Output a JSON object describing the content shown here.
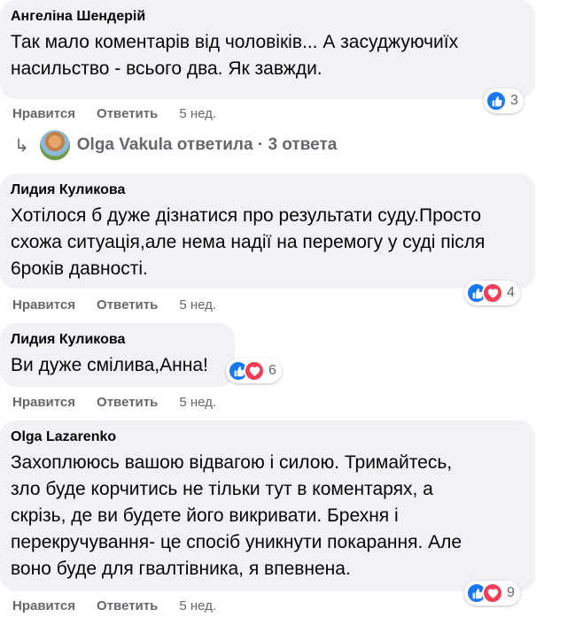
{
  "comments": [
    {
      "author": "Ангеліна Шендерій",
      "lines": [
        "Так мало коментарів від чоловіків... А засуджуючиїх",
        "насильство - всього два. Як завжди."
      ],
      "reactions": {
        "count": "3",
        "types": [
          "like"
        ]
      },
      "actions": {
        "like": "Нравится",
        "reply": "Ответить",
        "time": "5 нед."
      }
    },
    {
      "author": "Лидия Куликова",
      "lines": [
        "Хотілося б дуже дізнатися про результати суду.Просто",
        "схожа ситуація,але нема надії на перемогу у суді після",
        "6років давності."
      ],
      "reactions": {
        "count": "4",
        "types": [
          "like",
          "love"
        ]
      },
      "actions": {
        "like": "Нравится",
        "reply": "Ответить",
        "time": "5 нед."
      }
    },
    {
      "author": "Лидия Куликова",
      "lines": [
        "Ви дуже смілива,Анна!"
      ],
      "reactions": {
        "count": "6",
        "types": [
          "like",
          "love"
        ]
      },
      "actions": {
        "like": "Нравится",
        "reply": "Ответить",
        "time": "5 нед."
      }
    },
    {
      "author": "Olga Lazarenko",
      "lines": [
        "Захоплююсь вашою відвагою і силою. Тримайтесь,",
        "зло буде корчитись не тільки тут в коментарях, а",
        "скрізь, де ви будете його викривати. Брехня і",
        "перекручування- це спосіб уникнути покарання. Але",
        "воно буде для гвалтівника, я впевнена."
      ],
      "reactions": {
        "count": "9",
        "types": [
          "like",
          "love"
        ]
      },
      "actions": {
        "like": "Нравится",
        "reply": "Ответить",
        "time": "5 нед."
      }
    }
  ],
  "replies_thread": {
    "text": "Olga Vakula ответила · 3 ответа",
    "avatar_icon": "user-avatar"
  },
  "colors": {
    "bubble": "#f0f2f5",
    "like_blue": "#1877f2",
    "love_red": "#f33e58",
    "muted_text": "#65676b"
  }
}
